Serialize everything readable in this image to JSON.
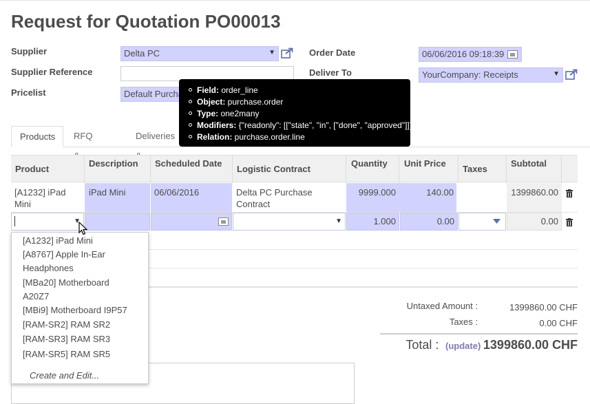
{
  "title": "Request for Quotation",
  "ref": "PO00013",
  "form": {
    "supplier_label": "Supplier",
    "supplier_value": "Delta PC",
    "supplier_ref_label": "Supplier Reference",
    "pricelist_label": "Pricelist",
    "pricelist_value": "Default Purcha",
    "order_date_label": "Order Date",
    "order_date_value": "06/06/2016 09:18:39",
    "deliver_to_label": "Deliver To",
    "deliver_to_value": "YourCompany: Receipts"
  },
  "tooltip": {
    "rows": [
      {
        "key": "Field:",
        "val": " order_line"
      },
      {
        "key": "Object:",
        "val": " purchase.order"
      },
      {
        "key": "Type:",
        "val": " one2many"
      },
      {
        "key": "Modifiers:",
        "val": " {\"readonly\": [[\"state\", \"in\", [\"done\", \"approved\"]]]}"
      },
      {
        "key": "Relation:",
        "val": " purchase.order.line"
      }
    ]
  },
  "tabs": [
    "Products",
    "RFQ & Bid",
    "Deliveries &"
  ],
  "table": {
    "headers": [
      "Product",
      "Description",
      "Scheduled Date",
      "Logistic Contract",
      "Quantity",
      "Unit Price",
      "Taxes",
      "Subtotal"
    ],
    "row": {
      "product": "[A1232] iPad Mini",
      "description": "iPad Mini",
      "date": "06/06/2016",
      "contract": "Delta PC Purchase Contract",
      "quantity": "9999.000",
      "unit_price": "140.00",
      "subtotal": "1399860.00"
    },
    "edit_row": {
      "quantity": "1.000",
      "unit_price": "0.00",
      "subtotal": "0.00"
    }
  },
  "dropdown": {
    "items": [
      "[A1232] iPad Mini",
      "[A8767] Apple In-Ear",
      "Headphones",
      "[MBa20] Motherboard",
      "A20Z7",
      "[MBi9] Motherboard I9P57",
      "[RAM-SR2] RAM SR2",
      "[RAM-SR3] RAM SR3",
      "[RAM-SR5] RAM SR5"
    ],
    "create": "Create and Edit..."
  },
  "totals": {
    "untaxed_label": "Untaxed Amount :",
    "untaxed_value": "1399860.00 CHF",
    "taxes_label": "Taxes :",
    "taxes_value": "0.00 CHF",
    "total_label": "Total :",
    "update_label": "(update)",
    "total_value": "1399860.00 CHF"
  },
  "colors": {
    "highlight": "#d2d2ff",
    "tooltip_bg": "#000000",
    "link": "#7c7bad"
  }
}
